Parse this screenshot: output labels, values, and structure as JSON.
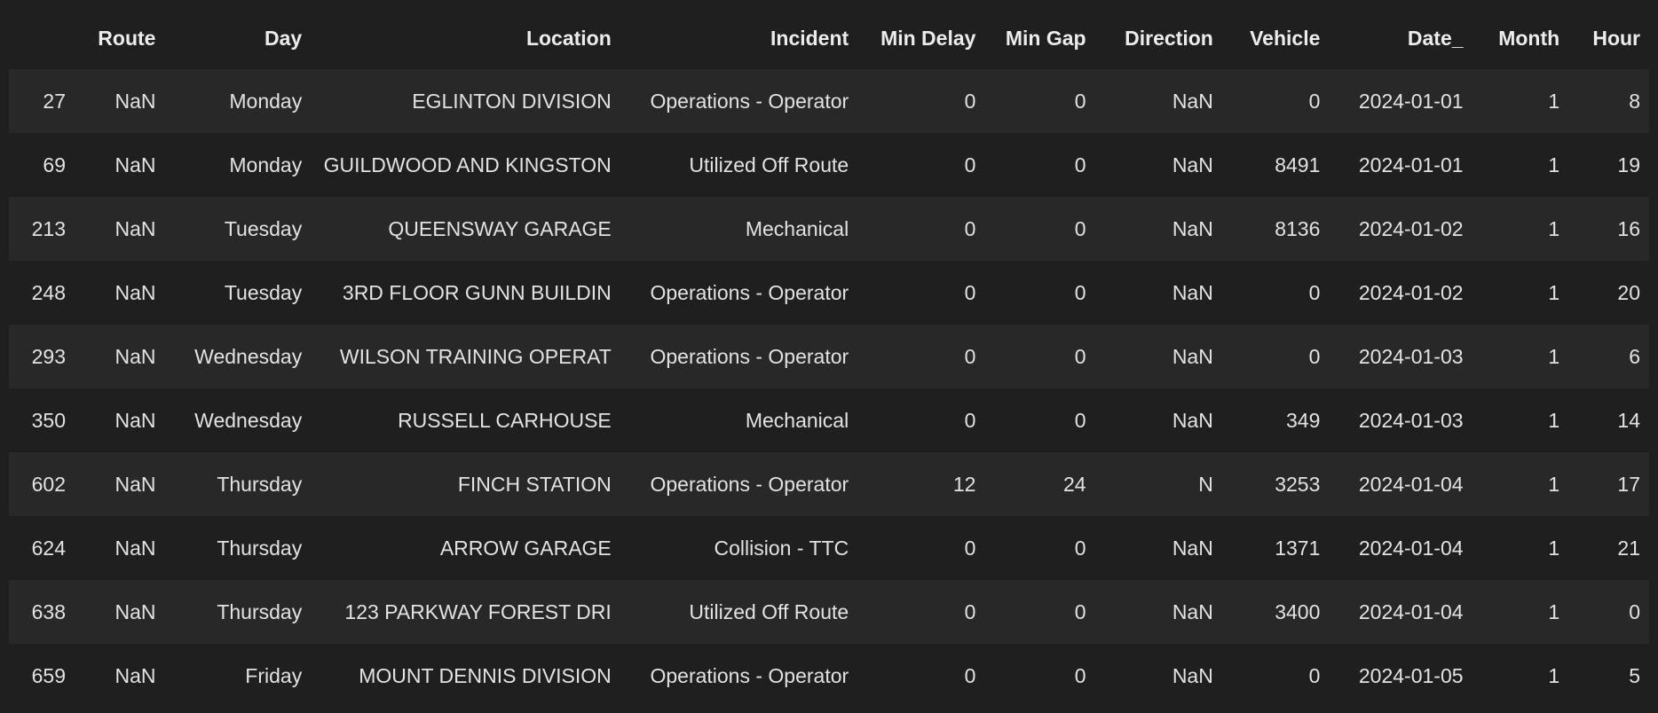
{
  "columns": [
    "",
    "Route",
    "Day",
    "Location",
    "Incident",
    "Min Delay",
    "Min Gap",
    "Direction",
    "Vehicle",
    "Date_",
    "Month",
    "Hour"
  ],
  "rows": [
    [
      "27",
      "NaN",
      "Monday",
      "EGLINTON DIVISION",
      "Operations - Operator",
      "0",
      "0",
      "NaN",
      "0",
      "2024-01-01",
      "1",
      "8"
    ],
    [
      "69",
      "NaN",
      "Monday",
      "GUILDWOOD AND KINGSTON",
      "Utilized Off Route",
      "0",
      "0",
      "NaN",
      "8491",
      "2024-01-01",
      "1",
      "19"
    ],
    [
      "213",
      "NaN",
      "Tuesday",
      "QUEENSWAY GARAGE",
      "Mechanical",
      "0",
      "0",
      "NaN",
      "8136",
      "2024-01-02",
      "1",
      "16"
    ],
    [
      "248",
      "NaN",
      "Tuesday",
      "3RD FLOOR GUNN BUILDIN",
      "Operations - Operator",
      "0",
      "0",
      "NaN",
      "0",
      "2024-01-02",
      "1",
      "20"
    ],
    [
      "293",
      "NaN",
      "Wednesday",
      "WILSON TRAINING OPERAT",
      "Operations - Operator",
      "0",
      "0",
      "NaN",
      "0",
      "2024-01-03",
      "1",
      "6"
    ],
    [
      "350",
      "NaN",
      "Wednesday",
      "RUSSELL CARHOUSE",
      "Mechanical",
      "0",
      "0",
      "NaN",
      "349",
      "2024-01-03",
      "1",
      "14"
    ],
    [
      "602",
      "NaN",
      "Thursday",
      "FINCH STATION",
      "Operations - Operator",
      "12",
      "24",
      "N",
      "3253",
      "2024-01-04",
      "1",
      "17"
    ],
    [
      "624",
      "NaN",
      "Thursday",
      "ARROW GARAGE",
      "Collision - TTC",
      "0",
      "0",
      "NaN",
      "1371",
      "2024-01-04",
      "1",
      "21"
    ],
    [
      "638",
      "NaN",
      "Thursday",
      "123 PARKWAY FOREST DRI",
      "Utilized Off Route",
      "0",
      "0",
      "NaN",
      "3400",
      "2024-01-04",
      "1",
      "0"
    ],
    [
      "659",
      "NaN",
      "Friday",
      "MOUNT DENNIS DIVISION",
      "Operations - Operator",
      "0",
      "0",
      "NaN",
      "0",
      "2024-01-05",
      "1",
      "5"
    ]
  ],
  "colors": {
    "background": "#1f1f1f",
    "row_stripe": "#282828",
    "text": "#e2e2e2"
  }
}
